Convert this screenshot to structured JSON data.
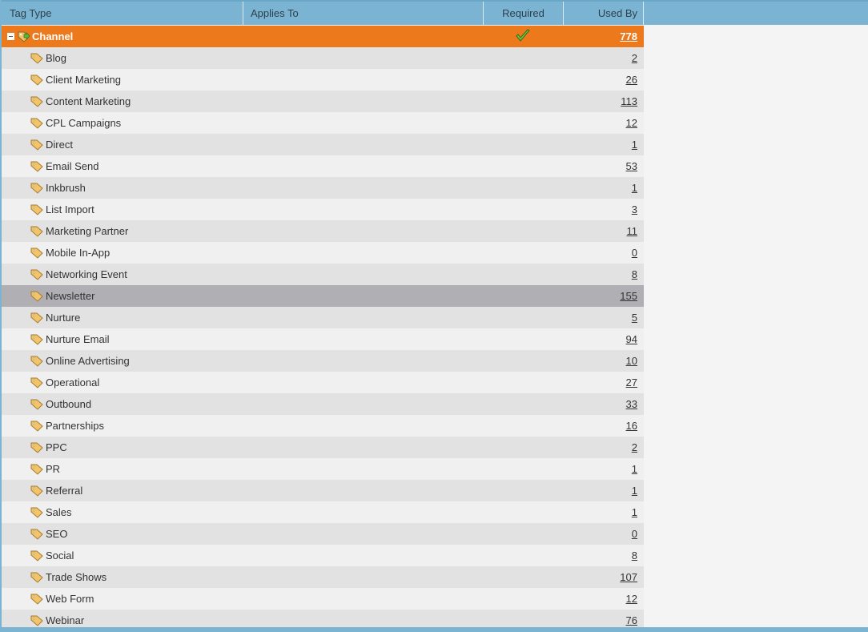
{
  "columns": {
    "tag_type": "Tag Type",
    "applies_to": "Applies To",
    "required": "Required",
    "used_by": "Used By"
  },
  "group": {
    "label": "Channel",
    "used_by": "778",
    "required": true
  },
  "items": [
    {
      "label": "Blog",
      "used_by": "2"
    },
    {
      "label": "Client Marketing",
      "used_by": "26"
    },
    {
      "label": "Content Marketing",
      "used_by": "113"
    },
    {
      "label": "CPL Campaigns",
      "used_by": "12"
    },
    {
      "label": "Direct",
      "used_by": "1"
    },
    {
      "label": "Email Send",
      "used_by": "53"
    },
    {
      "label": "Inkbrush",
      "used_by": "1"
    },
    {
      "label": "List Import",
      "used_by": "3"
    },
    {
      "label": "Marketing Partner",
      "used_by": "11"
    },
    {
      "label": "Mobile In-App",
      "used_by": "0"
    },
    {
      "label": "Networking Event",
      "used_by": "8"
    },
    {
      "label": "Newsletter",
      "used_by": "155",
      "selected": true
    },
    {
      "label": "Nurture",
      "used_by": "5"
    },
    {
      "label": "Nurture Email",
      "used_by": "94"
    },
    {
      "label": "Online Advertising",
      "used_by": "10"
    },
    {
      "label": "Operational",
      "used_by": "27"
    },
    {
      "label": "Outbound",
      "used_by": "33"
    },
    {
      "label": "Partnerships",
      "used_by": "16"
    },
    {
      "label": "PPC",
      "used_by": "2"
    },
    {
      "label": "PR",
      "used_by": "1"
    },
    {
      "label": "Referral",
      "used_by": "1"
    },
    {
      "label": "Sales",
      "used_by": "1"
    },
    {
      "label": "SEO",
      "used_by": "0"
    },
    {
      "label": "Social",
      "used_by": "8"
    },
    {
      "label": "Trade Shows",
      "used_by": "107"
    },
    {
      "label": "Web Form",
      "used_by": "12"
    },
    {
      "label": "Webinar",
      "used_by": "76"
    }
  ],
  "colors": {
    "header": "#7ab4d2",
    "group_row": "#ec7a1c",
    "selected_row": "#b0afb4",
    "row_odd": "#e2e2e2",
    "row_even": "#f0f0f0"
  },
  "icons": {
    "group": "tag-group-icon",
    "item": "tag-icon",
    "required": "checkmark-icon",
    "toggle": "collapse-icon"
  }
}
